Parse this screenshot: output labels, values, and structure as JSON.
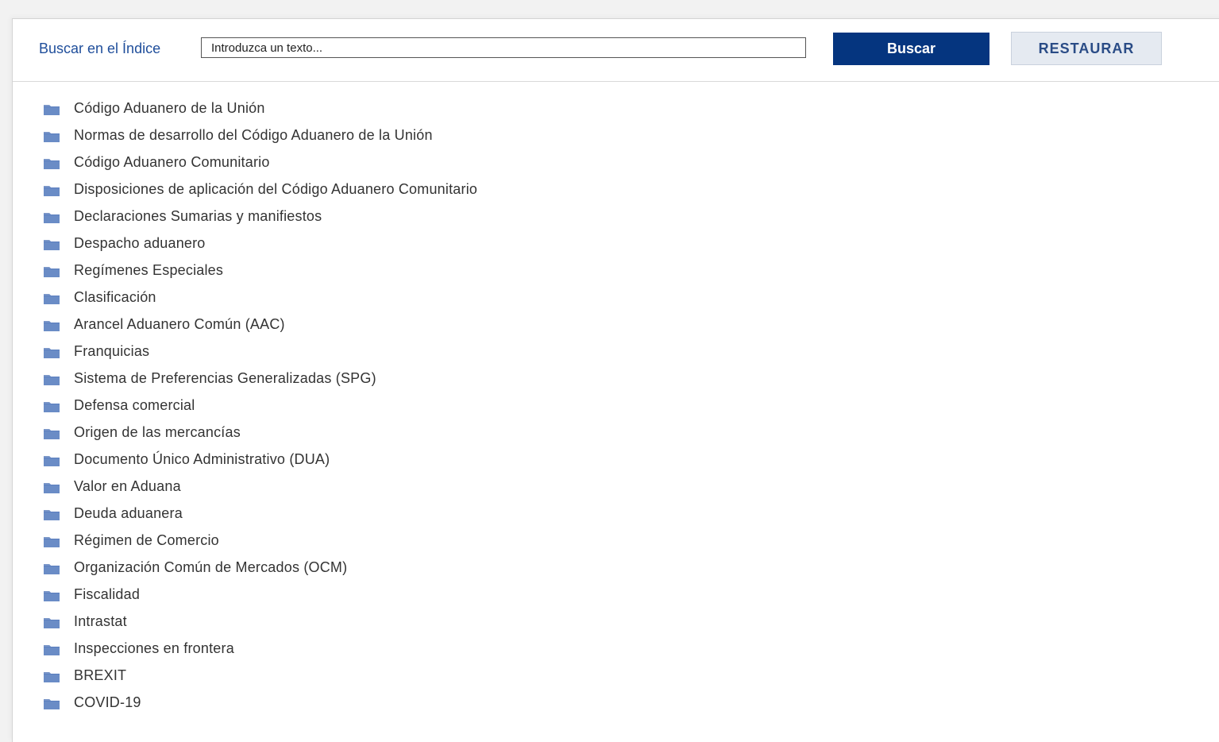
{
  "search": {
    "label": "Buscar en el Índice",
    "placeholder": "Introduzca un texto...",
    "value": "",
    "search_button": "Buscar",
    "reset_button": "RESTAURAR"
  },
  "colors": {
    "primary": "#05357f",
    "link": "#1f4e9b",
    "folder": "#5b7fbf",
    "text": "#333333"
  },
  "tree": {
    "icon": "folder-icon",
    "items": [
      {
        "label": "Código Aduanero de la Unión"
      },
      {
        "label": "Normas de desarrollo del Código Aduanero de la Unión"
      },
      {
        "label": "Código Aduanero Comunitario"
      },
      {
        "label": "Disposiciones de aplicación del Código Aduanero Comunitario"
      },
      {
        "label": "Declaraciones Sumarias y manifiestos"
      },
      {
        "label": "Despacho aduanero"
      },
      {
        "label": "Regímenes Especiales"
      },
      {
        "label": "Clasificación"
      },
      {
        "label": "Arancel Aduanero Común (AAC)"
      },
      {
        "label": "Franquicias"
      },
      {
        "label": "Sistema de Preferencias Generalizadas (SPG)"
      },
      {
        "label": "Defensa comercial"
      },
      {
        "label": "Origen de las mercancías"
      },
      {
        "label": "Documento Único Administrativo (DUA)"
      },
      {
        "label": "Valor en Aduana"
      },
      {
        "label": "Deuda aduanera"
      },
      {
        "label": "Régimen de Comercio"
      },
      {
        "label": "Organización Común de Mercados (OCM)"
      },
      {
        "label": "Fiscalidad"
      },
      {
        "label": "Intrastat"
      },
      {
        "label": "Inspecciones en frontera"
      },
      {
        "label": "BREXIT"
      },
      {
        "label": "COVID-19"
      }
    ]
  }
}
